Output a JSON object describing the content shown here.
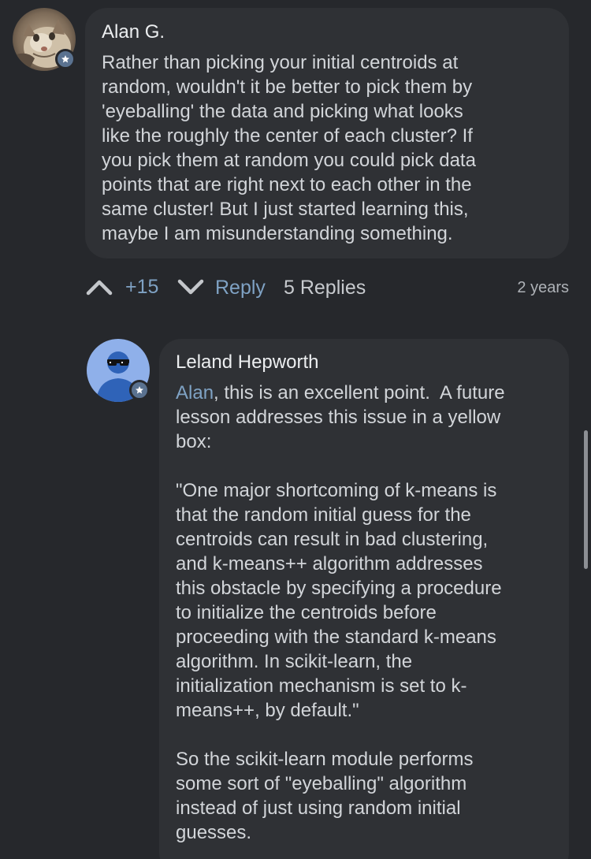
{
  "comment": {
    "author": "Alan G.",
    "text": "Rather than picking your initial centroids at\nrandom, wouldn't it be better to pick them by\n'eyeballing' the data and picking what looks\nlike the roughly the center of each cluster? If\nyou pick them at random you could pick data\npoints that are right next to each other in the\nsame cluster! But I just started learning this,\nmaybe I am misunderstanding something.",
    "avatar_icon": "cat-photo-avatar",
    "badge_icon": "star-icon",
    "actions": {
      "upvote_icon": "chevron-up-icon",
      "score": "+15",
      "downvote_icon": "chevron-down-icon",
      "reply_label": "Reply",
      "replies_label": "5 Replies",
      "timestamp": "2 years"
    }
  },
  "reply": {
    "author": "Leland Hepworth",
    "mention": "Alan",
    "text_after_mention": ", this is an excellent point.  A future\nlesson addresses this issue in a yellow\nbox:\n\n\"One major shortcoming of k-means is\nthat the random initial guess for the\ncentroids can result in bad clustering,\nand k-means++ algorithm addresses\nthis obstacle by specifying a procedure\nto initialize the centroids before\nproceeding with the standard k-means\nalgorithm. In scikit-learn, the\ninitialization mechanism is set to k-\nmeans++, by default.\"\n\nSo the scikit-learn module performs\nsome sort of \"eyeballing\" algorithm\ninstead of just using random initial\nguesses.",
    "avatar_icon": "person-sunglasses-avatar",
    "badge_icon": "star-icon"
  },
  "colors": {
    "background": "#26282c",
    "bubble": "#2f3135",
    "accent": "#7fa2c4",
    "badge": "#5a7290",
    "avatar_blue": "#8fb0ea"
  }
}
